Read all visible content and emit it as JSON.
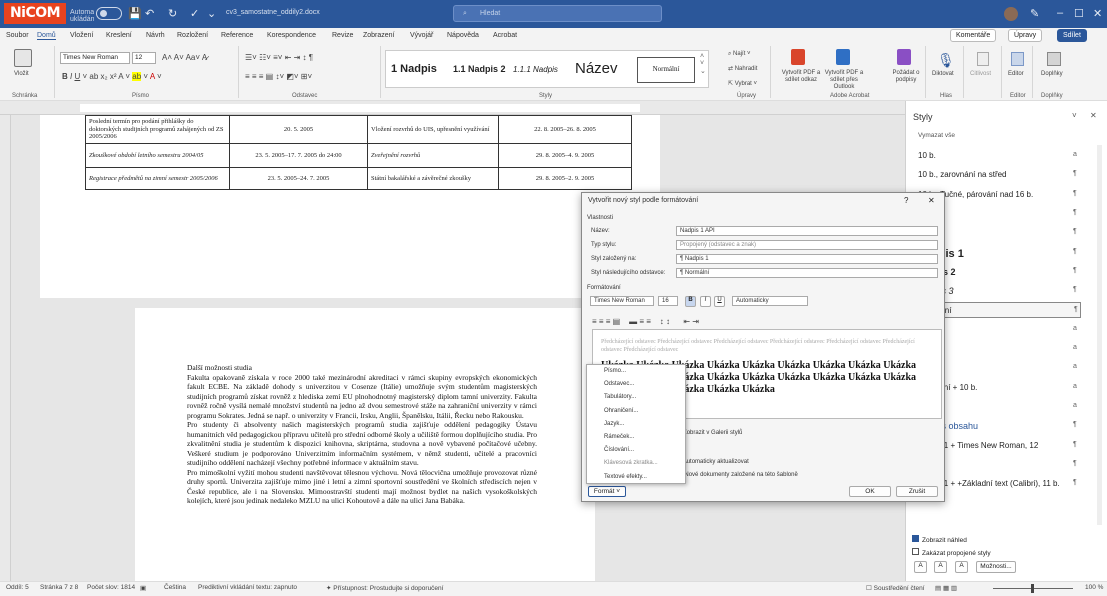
{
  "titlebar": {
    "logo": "NiCOM",
    "autosave": "Automatické ukládání",
    "filename": "cv3_samostatne_oddily2.docx",
    "search_placeholder": "Hledat"
  },
  "menu": {
    "items": [
      "Soubor",
      "Domů",
      "Vložení",
      "Kreslení",
      "Návrh",
      "Rozložení",
      "Reference",
      "Korespondence",
      "Revize",
      "Zobrazení",
      "Vývojář",
      "Nápověda",
      "Acrobat"
    ],
    "comments": "Komentáře",
    "edit": "Úpravy",
    "share": "Sdílet"
  },
  "ribbon": {
    "paste": "Vložit",
    "clipboard": "Schránka",
    "font_name": "Times New Roman",
    "font_size": "12",
    "font_group": "Písmo",
    "paragraph_group": "Odstavec",
    "styles_group": "Styly",
    "styles": [
      "1 Nadpis",
      "1.1 Nadpis 2",
      "1.1.1 Nadpis",
      "Název",
      "Normální"
    ],
    "find": "Najít",
    "replace": "Nahradit",
    "select": "Vybrat",
    "editing_group": "Úpravy",
    "acrobat": [
      "Vytvořit PDF a sdílet odkaz",
      "Vytvořit PDF a sdílet přes Outlook",
      "Požádat o podpisy"
    ],
    "acrobat_group": "Adobe Acrobat",
    "dictate": "Diktovat",
    "voice_group": "Hlas",
    "reading": "Citlivost",
    "editor": "Editor",
    "addins": "Doplňky",
    "editor_group": "Editor",
    "addins_group": "Doplňky"
  },
  "table": [
    [
      "Poslední termín pro podání přihlášky do doktorských studijních programů zahájených od ZS 2005/2006",
      "20. 5. 2005",
      "Vložení rozvrhů do UIS, upřesnění využívání",
      "22. 8. 2005–26. 8. 2005"
    ],
    [
      "Zkouškové období letního semestru 2004/05",
      "23. 5. 2005–17. 7. 2005 do 24:00",
      "Zveřejnění rozvrhů",
      "29. 8. 2005–4. 9. 2005"
    ],
    [
      "Registrace předmětů na zimní semestr 2005/2006",
      "23. 5. 2005–24. 7. 2005",
      "Státní bakalářské a závěrečné zkoušky",
      "29. 8. 2005–2. 9. 2005"
    ]
  ],
  "document": {
    "heading": "Další možnosti studia",
    "p1": "Fakulta opakovaně získala v roce 2000 také mezinárodní akreditaci v rámci skupiny evropských ekonomických fakult ECBE. Na základě dohody s univerzitou v Cosenze (Itálie) umožňuje svým studentům magisterských studijních programů získat rovněž z hlediska zemí EU plnohodnotný magisterský diplom tamní univerzity. Fakulta rovněž ročně vysílá nemalé množství studentů na jedno až dvou semestrové stáže na zahraniční univerzity v rámci programu Sokrates. Jedná se např. o univerzity v Francii, Irsku, Anglii, Španělsku, Itálii, Řecku nebo Rakousku.",
    "p2": "Pro studenty či absolventy našich magisterských programů studia zajišťuje oddělení pedagogiky Ústavu humanitních věd pedagogickou přípravu učitelů pro střední odborné školy a učiliště formou doplňujícího studia. Pro zkvalitnění studia je studentům k dispozici knihovna, skriptárna, studovna a nově vybavené počítačové učebny. Veškeré studium je podporováno Univerzitním informačním systémem, v němž studenti, učitelé a pracovníci studijního oddělení nacházejí všechny potřebné informace v aktuálním stavu.",
    "p3": "Pro mimoškolní vyžití mohou studenti navštěvovat tělesnou výchovu. Nová tělocvična umožňuje provozovat různé druhy sportů. Univerzita zajišťuje mimo jiné i letní a zimní sportovní soustředění ve školních střediscích nejen v České republice, ale i na Slovensku. Mimoostravští studenti mají možnost bydlet na našich vysokoškolských kolejích, které jsou jedinak nedaleko MZLU na ulici Kohoutově a dále na ulici Jana Babáka."
  },
  "styles_pane": {
    "title": "Styly",
    "clear_all": "Vymazat vše",
    "items": [
      {
        "label": "10 b.",
        "mark": "a"
      },
      {
        "label": "10 b., zarovnání na střed",
        "mark": "¶"
      },
      {
        "label": "10 b., Tučné, párování nad 16 b.",
        "mark": "¶"
      },
      {
        "label": "",
        "mark": "¶"
      },
      {
        "label": "",
        "mark": "¶"
      },
      {
        "label": "Nadpis 1",
        "mark": "¶"
      },
      {
        "label": "Nadpis 2",
        "mark": "¶"
      },
      {
        "label": "Nadpis 3",
        "mark": "¶"
      },
      {
        "label": "Normální",
        "mark": "¶"
      },
      {
        "label": "",
        "mark": "a"
      },
      {
        "label": "10 b.",
        "mark": "a"
      },
      {
        "label": "",
        "mark": "a"
      },
      {
        "label": "Normální + 10 b.",
        "mark": "a"
      },
      {
        "label": "Obsah",
        "mark": "a"
      },
      {
        "label": "Nadpis obsahu",
        "mark": "¶"
      },
      {
        "label": "Obsah 1 + Times New Roman, 12",
        "mark": "¶"
      },
      {
        "label": "",
        "mark": "¶"
      },
      {
        "label": "Obsah 1 + +Základní text (Calibri), 11 b.",
        "mark": "¶"
      }
    ],
    "show_preview": "Zobrazit náhled",
    "disable_linked": "Zakázat propojené styly",
    "options": "Možnosti..."
  },
  "dialog": {
    "title": "Vytvořit nový styl podle formátování",
    "properties": "Vlastnosti",
    "name_label": "Název:",
    "name_value": "Nadpis 1 API",
    "type_label": "Typ stylu:",
    "type_value": "Propojený (odstavec a znak)",
    "based_label": "Styl založený na:",
    "based_value": "¶ Nadpis 1",
    "next_label": "Styl následujícího odstavce:",
    "next_value": "¶ Normální",
    "formatting": "Formátování",
    "font": "Times New Roman",
    "size": "16",
    "color": "Automaticky",
    "preview_gray": "Předcházející odstavec Předcházející odstavec Předcházející odstavec Předcházející odstavec Předcházející odstavec Předcházející odstavec Předcházející odstavec",
    "preview_sample": "Ukázka Ukázka Ukázka Ukázka Ukázka Ukázka Ukázka Ukázka Ukázka Ukázka Ukázka Ukázka Ukázka Ukázka Ukázka Ukázka Ukázka Ukázka Ukázka Ukázka Ukázka Ukázka Ukázka",
    "add_gallery": "Zobrazit v Galerii stylů",
    "auto_update": "Automaticky aktualizovat",
    "new_docs": "Nové dokumenty založené na této šabloně",
    "format_btn": "Formát",
    "ok": "OK",
    "cancel": "Zrušit"
  },
  "context_menu": [
    "Písmo...",
    "Odstavec...",
    "Tabulátory...",
    "Ohraničení...",
    "Jazyk...",
    "Rámeček...",
    "Číslování...",
    "Klávesová zkratka...",
    "Textové efekty..."
  ],
  "status": {
    "section": "Oddíl: 5",
    "page": "Stránka 7 z 8",
    "words": "Počet slov: 1814",
    "language": "Čeština",
    "prediction": "Prediktivní vkládání textu: zapnuto",
    "accessibility": "Přístupnost: Prostudujte si doporučení",
    "focus": "Soustředění čtení",
    "zoom": "100 %"
  }
}
